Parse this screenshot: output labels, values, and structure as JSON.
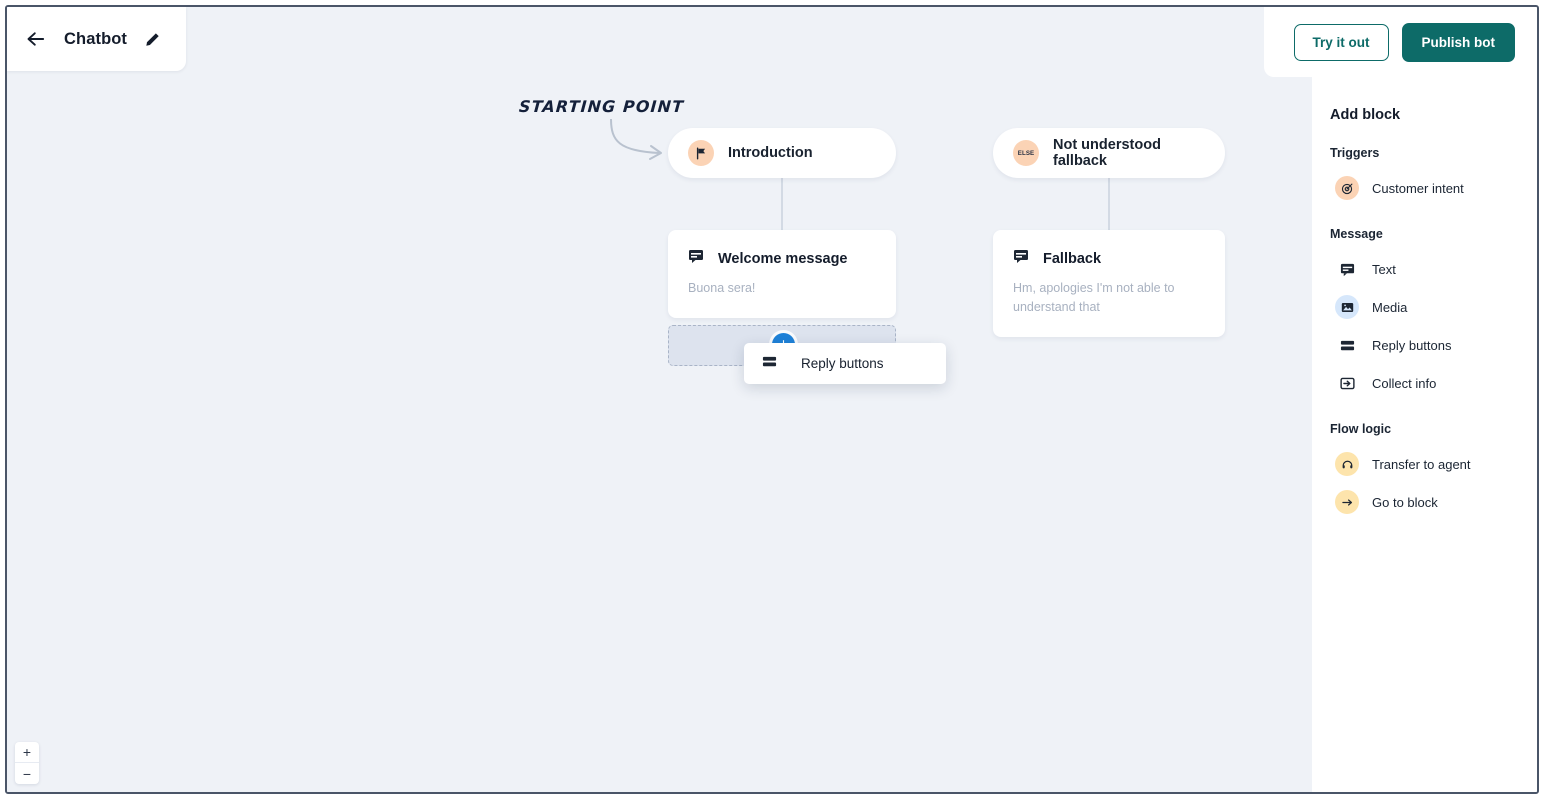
{
  "header": {
    "back_icon": "arrow-left-icon",
    "title": "Chatbot",
    "edit_icon": "pencil-icon"
  },
  "actions": {
    "try_label": "Try it out",
    "publish_label": "Publish bot",
    "accent_color": "#0d6b68"
  },
  "canvas": {
    "starting_point_label": "STARTING POINT",
    "nodes": [
      {
        "id": "introduction",
        "label": "Introduction",
        "badge_icon": "flag-icon",
        "badge_text": ""
      },
      {
        "id": "not-understood-fallback",
        "label": "Not understood fallback",
        "badge_icon": "else-badge",
        "badge_text": "ELSE"
      }
    ],
    "cards": [
      {
        "id": "welcome-message",
        "title": "Welcome message",
        "icon": "chat-bubble-icon",
        "body": "Buona sera!"
      },
      {
        "id": "fallback",
        "title": "Fallback",
        "icon": "chat-bubble-icon",
        "body": "Hm, apologies I'm not able to understand that"
      }
    ],
    "dropzone": {
      "add_icon": "plus-icon",
      "accent_color": "#1f82d8"
    },
    "drag_ghost": {
      "label": "Reply buttons",
      "icon": "reply-buttons-icon"
    },
    "zoom_controls": {
      "zoom_in": "+",
      "zoom_out": "−"
    }
  },
  "sidebar": {
    "title": "Add block",
    "groups": [
      {
        "title": "Triggers",
        "items": [
          {
            "label": "Customer intent",
            "icon": "target-icon",
            "icon_bg": "peach"
          }
        ]
      },
      {
        "title": "Message",
        "items": [
          {
            "label": "Text",
            "icon": "chat-bubble-icon",
            "icon_bg": "plain"
          },
          {
            "label": "Media",
            "icon": "image-icon",
            "icon_bg": "blue"
          },
          {
            "label": "Reply buttons",
            "icon": "reply-buttons-icon",
            "icon_bg": "plain"
          },
          {
            "label": "Collect info",
            "icon": "collect-info-icon",
            "icon_bg": "plain"
          }
        ]
      },
      {
        "title": "Flow logic",
        "items": [
          {
            "label": "Transfer to agent",
            "icon": "agent-icon",
            "icon_bg": "amber"
          },
          {
            "label": "Go to block",
            "icon": "arrow-right-icon",
            "icon_bg": "amber"
          }
        ]
      }
    ]
  }
}
